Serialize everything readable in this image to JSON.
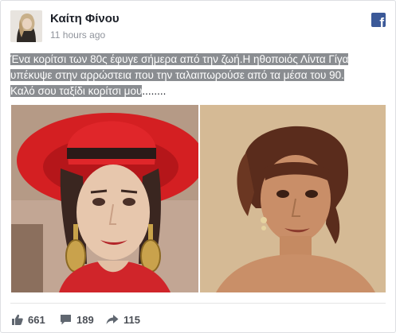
{
  "post": {
    "author": "Καίτη Φίνου",
    "time": "11 hours ago",
    "text_lines": [
      "Ένα κορίτσι των 80ς έφυγε σήμερα από την ζωή.Η ηθοποιός Λίντα Γίγα",
      "υπέκυψε στην αρρώστεια που την ταλαιπωρούσε από τα μέσα του 90.",
      "Καλό σου ταξίδι κορίτσι μου"
    ],
    "text_tail": "........"
  },
  "brand": {
    "logo_letter": "f",
    "color": "#3b5998"
  },
  "stats": {
    "likes": "661",
    "comments": "189",
    "shares": "115"
  },
  "icons": [
    "facebook-logo-icon",
    "like-icon",
    "comment-icon",
    "share-icon"
  ]
}
